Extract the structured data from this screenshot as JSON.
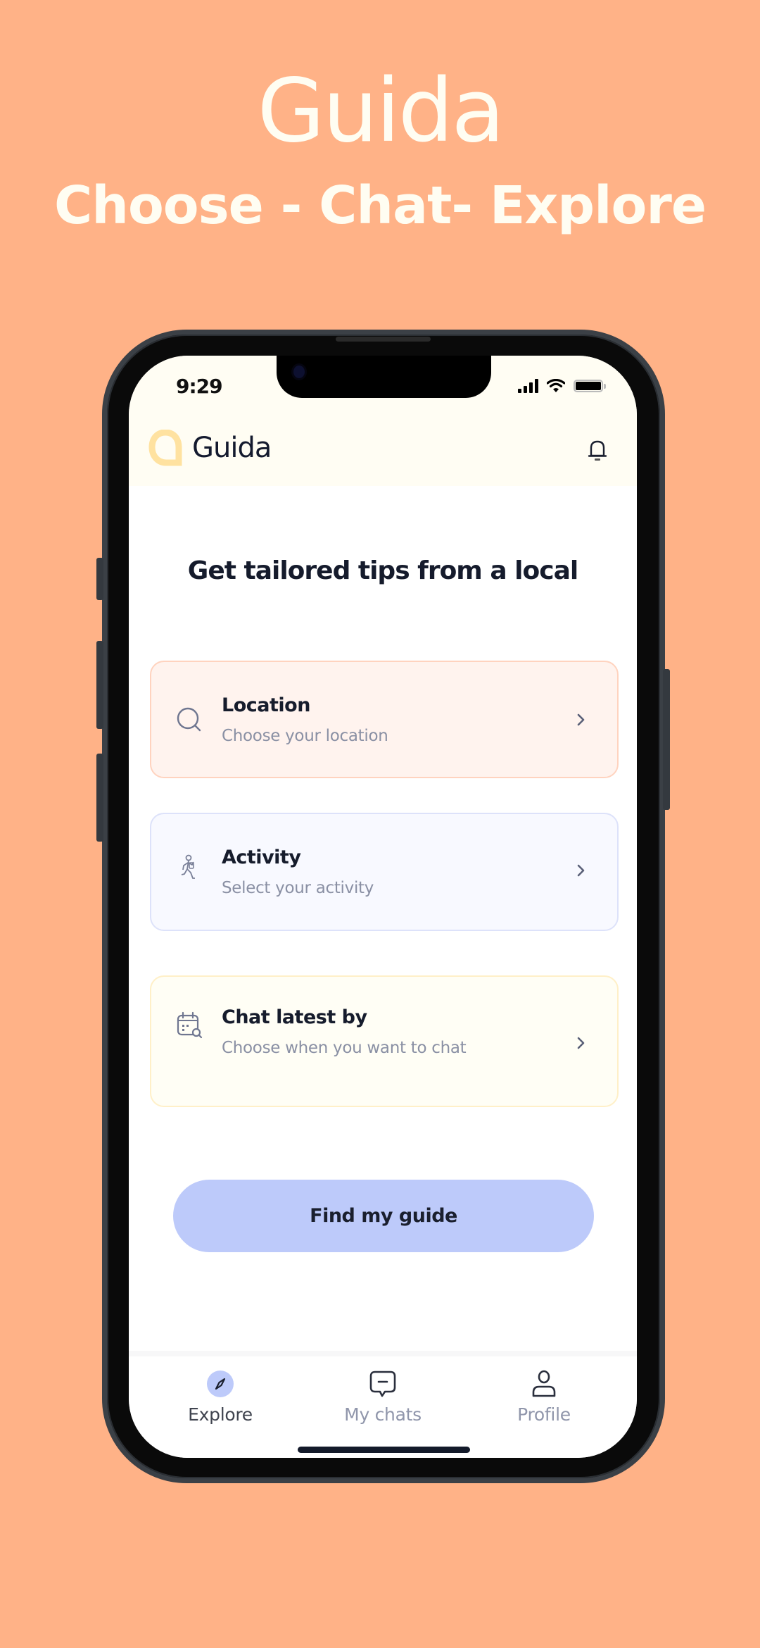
{
  "promo": {
    "logo_text": "Guida",
    "tagline": "Choose - Chat- Explore"
  },
  "status_bar": {
    "time": "9:29",
    "icons": [
      "cellular-signal-icon",
      "wifi-icon",
      "battery-icon"
    ]
  },
  "header": {
    "brand_name": "Guida",
    "brand_icon": "guida-logo-icon",
    "notification_icon": "bell-icon"
  },
  "main": {
    "headline": "Get tailored tips from a local",
    "cards": [
      {
        "id": "location",
        "title": "Location",
        "subtitle": "Choose your location",
        "icon": "search-icon",
        "accent_bg": "#FFF3EE",
        "accent_border": "#FFD3BF"
      },
      {
        "id": "activity",
        "title": "Activity",
        "subtitle": "Select your activity",
        "icon": "hiker-icon",
        "accent_bg": "#F8F9FF",
        "accent_border": "#DDE2FA"
      },
      {
        "id": "chat-latest-by",
        "title": "Chat latest by",
        "subtitle": "Choose when you want to chat",
        "icon": "calendar-search-icon",
        "accent_bg": "#FFFEF5",
        "accent_border": "#FFF0C8"
      }
    ],
    "cta_label": "Find  my guide"
  },
  "tabbar": {
    "tabs": [
      {
        "label": "Explore",
        "icon": "compass-icon",
        "active": true
      },
      {
        "label": "My chats",
        "icon": "chat-bubble-icon",
        "active": false
      },
      {
        "label": "Profile",
        "icon": "user-icon",
        "active": false
      }
    ]
  },
  "colors": {
    "background": "#FFB287",
    "promo_text": "#FFFDF2",
    "header_bg": "#FFFDF3",
    "brand_yellow": "#FFE2A0",
    "primary_button": "#BDCAFA",
    "text_dark": "#151B2C",
    "text_muted": "#8A90A4"
  }
}
